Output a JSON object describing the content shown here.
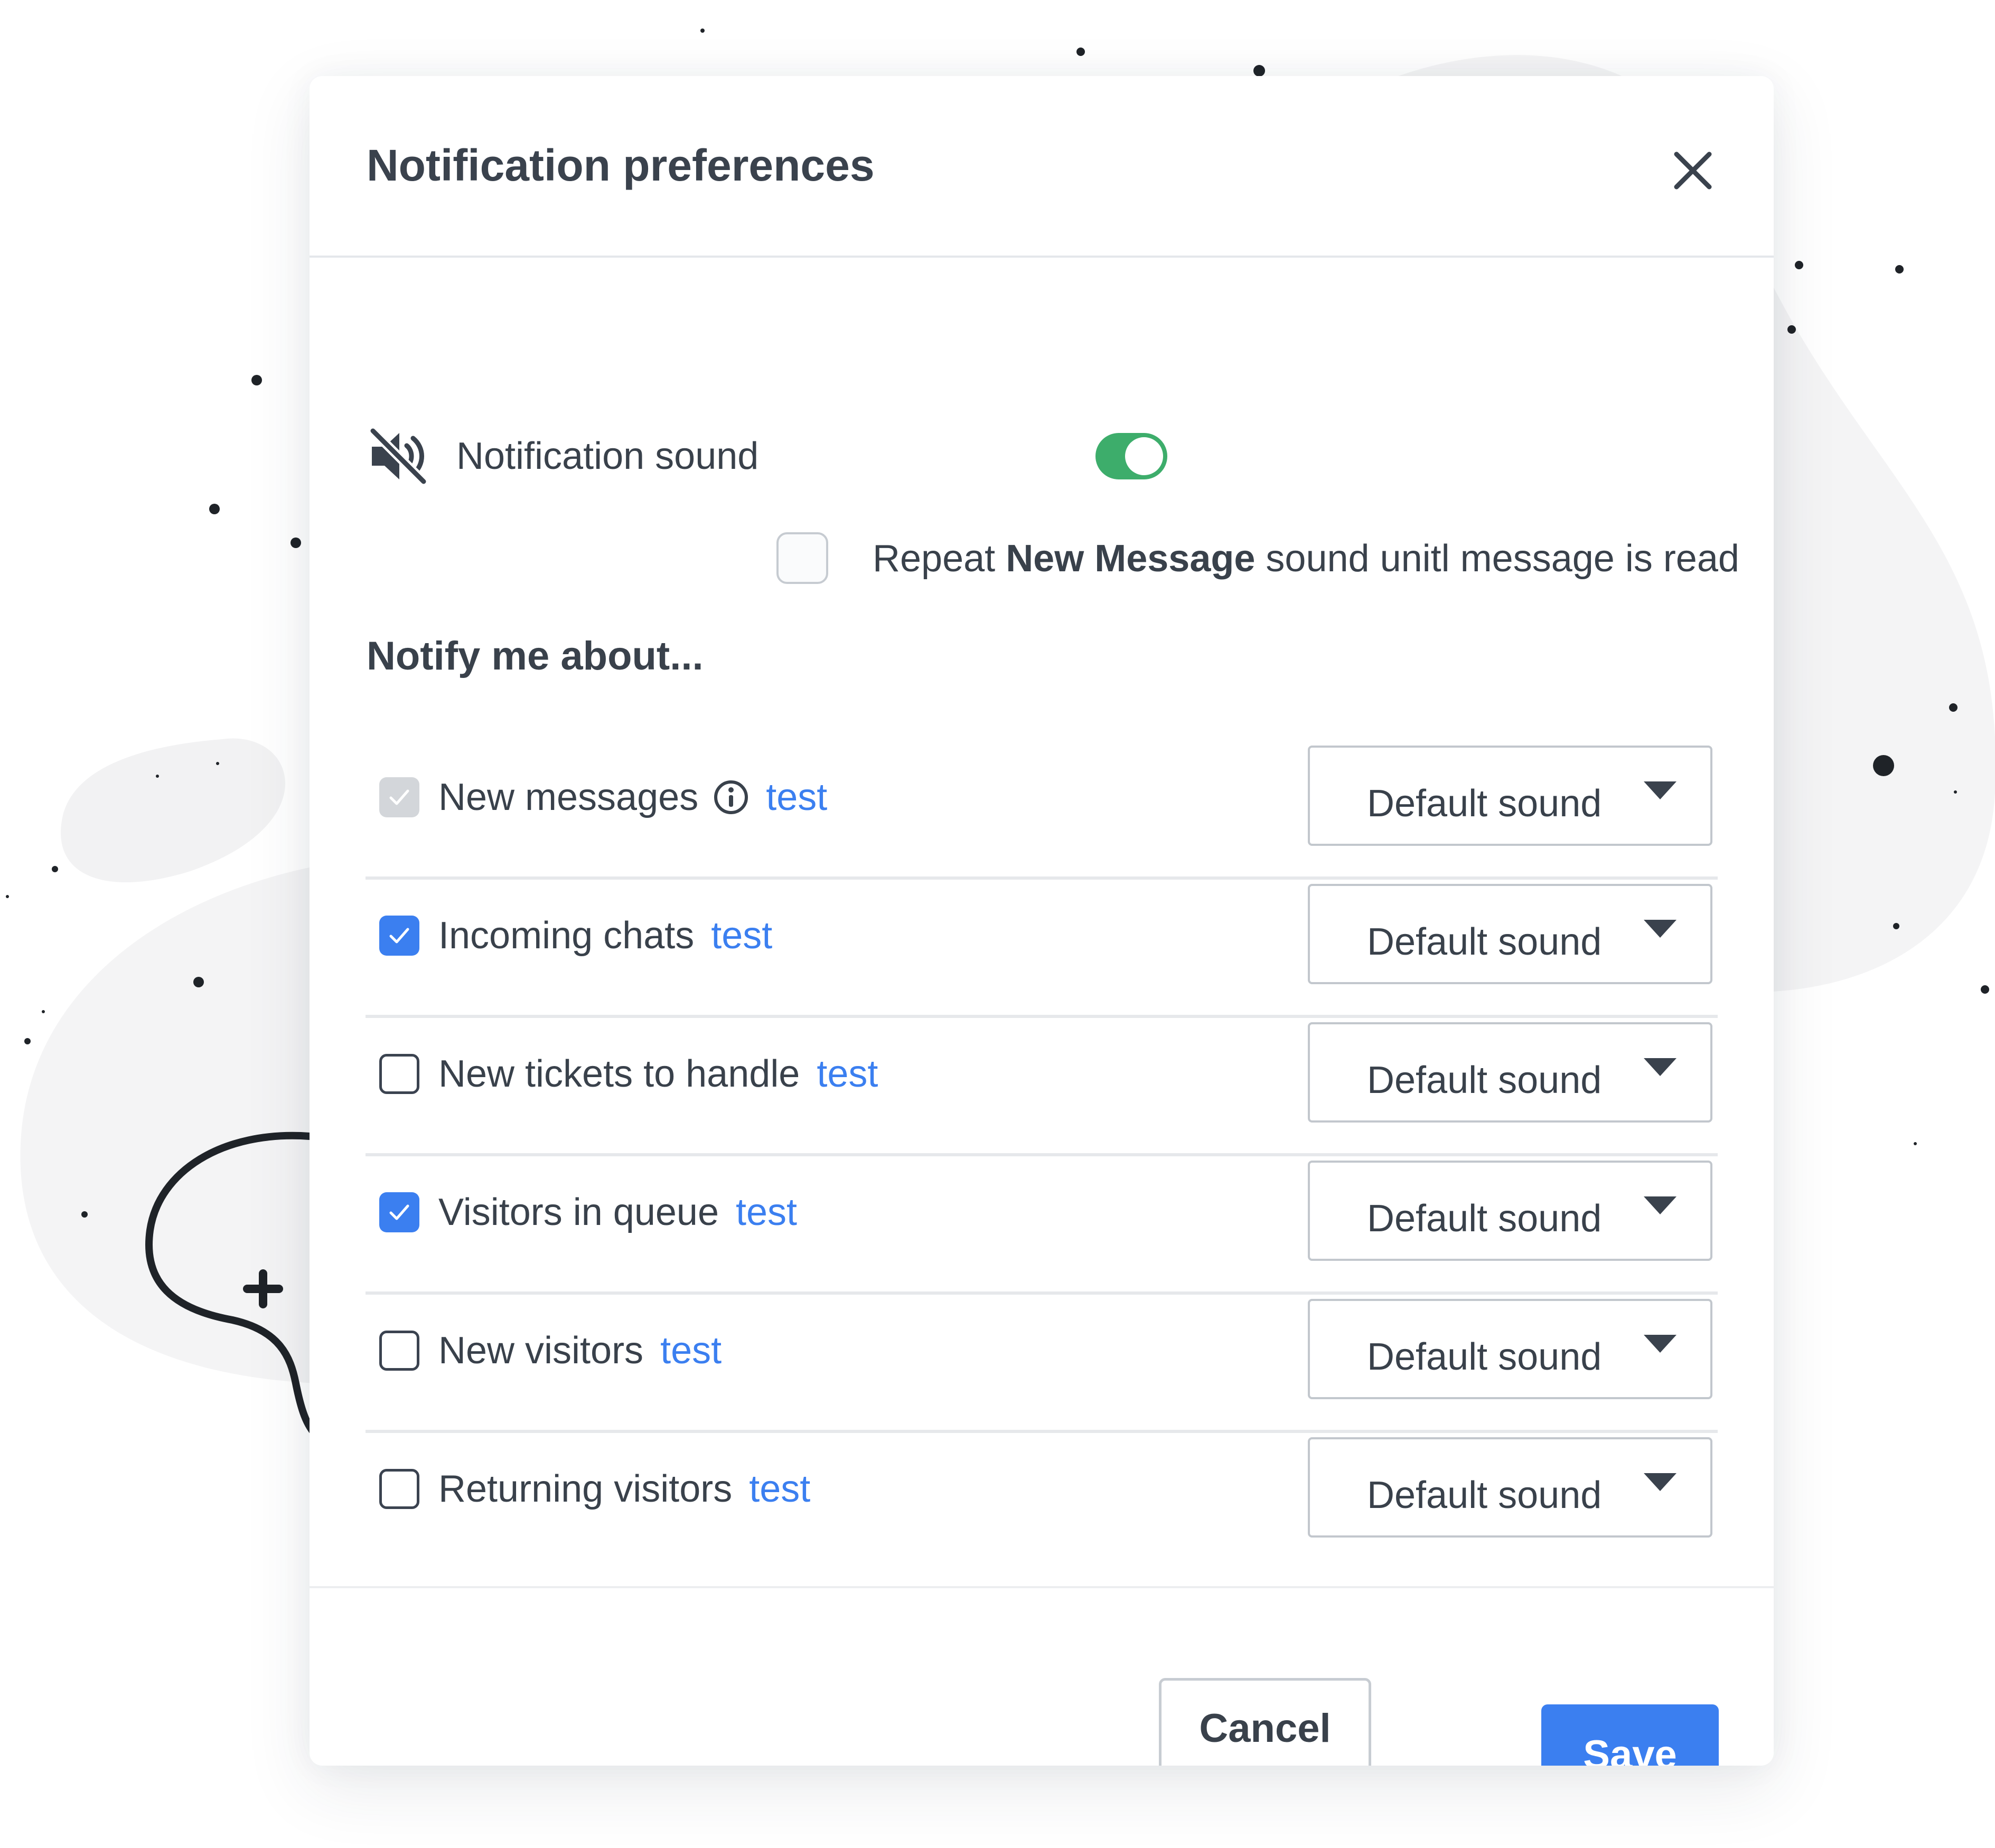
{
  "dialog": {
    "title": "Notification preferences",
    "close_icon": "close-icon"
  },
  "sound": {
    "icon": "volume-mute-icon",
    "label": "Notification sound",
    "enabled": true
  },
  "repeat": {
    "prefix": "Repeat ",
    "bold": "New Message",
    "suffix": " sound unitl message is read",
    "checked": false
  },
  "notify": {
    "title": "Notify me about...",
    "rows": [
      {
        "label": "New messages",
        "test": "test",
        "sound": "Default sound",
        "state": "disabled-checked",
        "info": true
      },
      {
        "label": "Incoming chats",
        "test": "test",
        "sound": "Default sound",
        "state": "checked"
      },
      {
        "label": "New tickets to handle",
        "test": "test",
        "sound": "Default sound",
        "state": "unchecked"
      },
      {
        "label": "Visitors in queue",
        "test": "test",
        "sound": "Default sound",
        "state": "checked"
      },
      {
        "label": "New visitors",
        "test": "test",
        "sound": "Default sound",
        "state": "unchecked"
      },
      {
        "label": "Returning visitors",
        "test": "test",
        "sound": "Default sound",
        "state": "unchecked"
      }
    ]
  },
  "footer": {
    "cancel_label": "Cancel",
    "save_label": "Save"
  },
  "colors": {
    "accent": "#3b7ff0",
    "toggle_on": "#3dad6b",
    "text": "#39414b"
  }
}
